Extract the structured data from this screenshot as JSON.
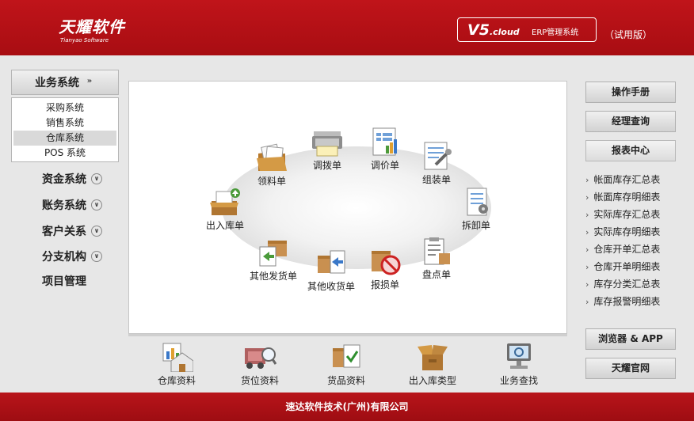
{
  "header": {
    "logo_main": "天耀软件",
    "logo_sub": "Tianyao Software",
    "version_v5": "V5",
    "version_cloud": ".cloud",
    "version_erp": "ERP管理系统",
    "trial": "（试用版）"
  },
  "sidebar": {
    "business_label": "业务系统",
    "submenu": [
      "采购系统",
      "销售系统",
      "仓库系统",
      "POS 系统"
    ],
    "groups": [
      {
        "label": "资金系统"
      },
      {
        "label": "账务系统"
      },
      {
        "label": "客户关系"
      },
      {
        "label": "分支机构"
      },
      {
        "label": "项目管理"
      }
    ]
  },
  "flow": {
    "nodes": [
      {
        "label": "领料单",
        "icon": "folder-documents-icon"
      },
      {
        "label": "调拨单",
        "icon": "printer-icon"
      },
      {
        "label": "调价单",
        "icon": "spreadsheet-chart-icon"
      },
      {
        "label": "组装单",
        "icon": "document-wrench-icon"
      },
      {
        "label": "拆卸单",
        "icon": "document-tools-icon"
      },
      {
        "label": "出入库单",
        "icon": "box-upload-icon"
      },
      {
        "label": "其他发货单",
        "icon": "box-document-out-icon"
      },
      {
        "label": "其他收货单",
        "icon": "box-document-in-icon"
      },
      {
        "label": "报损单",
        "icon": "box-prohibited-icon"
      },
      {
        "label": "盘点单",
        "icon": "clipboard-box-icon"
      }
    ]
  },
  "bottom_nav": [
    {
      "label": "仓库资料",
      "icon": "warehouse-chart-icon"
    },
    {
      "label": "货位资料",
      "icon": "truck-search-icon"
    },
    {
      "label": "货品资料",
      "icon": "box-check-icon"
    },
    {
      "label": "出入库类型",
      "icon": "open-box-icon"
    },
    {
      "label": "业务查找",
      "icon": "monitor-search-icon"
    }
  ],
  "right_sidebar": {
    "manual": "操作手册",
    "manager_query": "经理查询",
    "report_center": "报表中心",
    "reports": [
      "帐面库存汇总表",
      "帐面库存明细表",
      "实际库存汇总表",
      "实际库存明细表",
      "仓库开单汇总表",
      "仓库开单明细表",
      "库存分类汇总表",
      "库存报警明细表"
    ],
    "browser_app": "浏览器 & APP",
    "official_site": "天耀官网"
  },
  "footer": {
    "company": "速达软件技术(广州)有限公司"
  },
  "colors": {
    "brand_red": "#b3101a",
    "panel_bg": "#e7e7e7"
  }
}
